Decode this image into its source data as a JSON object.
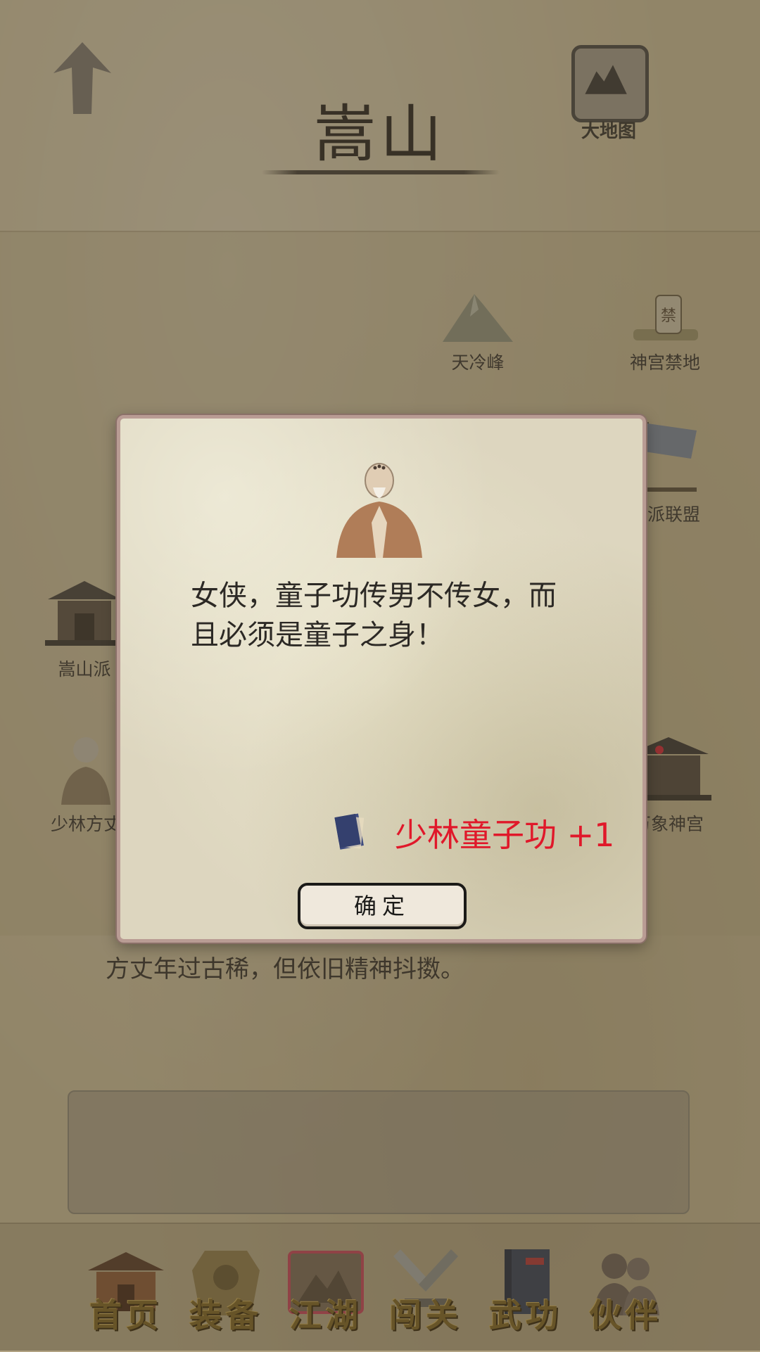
{
  "header": {
    "title": "嵩山",
    "map_button_label": "大地图"
  },
  "locations": [
    {
      "label": "天冷峰",
      "icon": "mountain-icon"
    },
    {
      "label": "神宫禁地",
      "icon": "forbidden-sign-icon"
    },
    {
      "label": "五派联盟",
      "icon": "flag-icon"
    },
    {
      "label": "嵩山派",
      "icon": "temple-icon"
    },
    {
      "label": "少林方丈",
      "icon": "monk-icon"
    },
    {
      "label": "万象神宫",
      "icon": "palace-icon"
    }
  ],
  "description": "方丈年过古稀，但依旧精神抖擞。",
  "dialog": {
    "message": "女侠，童子功传男不传女，而且必须是童子之身！",
    "reward_text": "少林童子功 +1",
    "reward_icon": "book-icon",
    "ok_label": "确定"
  },
  "nav": [
    {
      "label": "首页",
      "icon": "home-building-icon"
    },
    {
      "label": "装备",
      "icon": "armor-icon"
    },
    {
      "label": "江湖",
      "icon": "scroll-map-icon"
    },
    {
      "label": "闯关",
      "icon": "crossed-swords-icon"
    },
    {
      "label": "武功",
      "icon": "manual-book-icon"
    },
    {
      "label": "伙伴",
      "icon": "people-icon"
    }
  ],
  "colors": {
    "reward": "#e0182a",
    "nav_label": "#7d6428"
  }
}
